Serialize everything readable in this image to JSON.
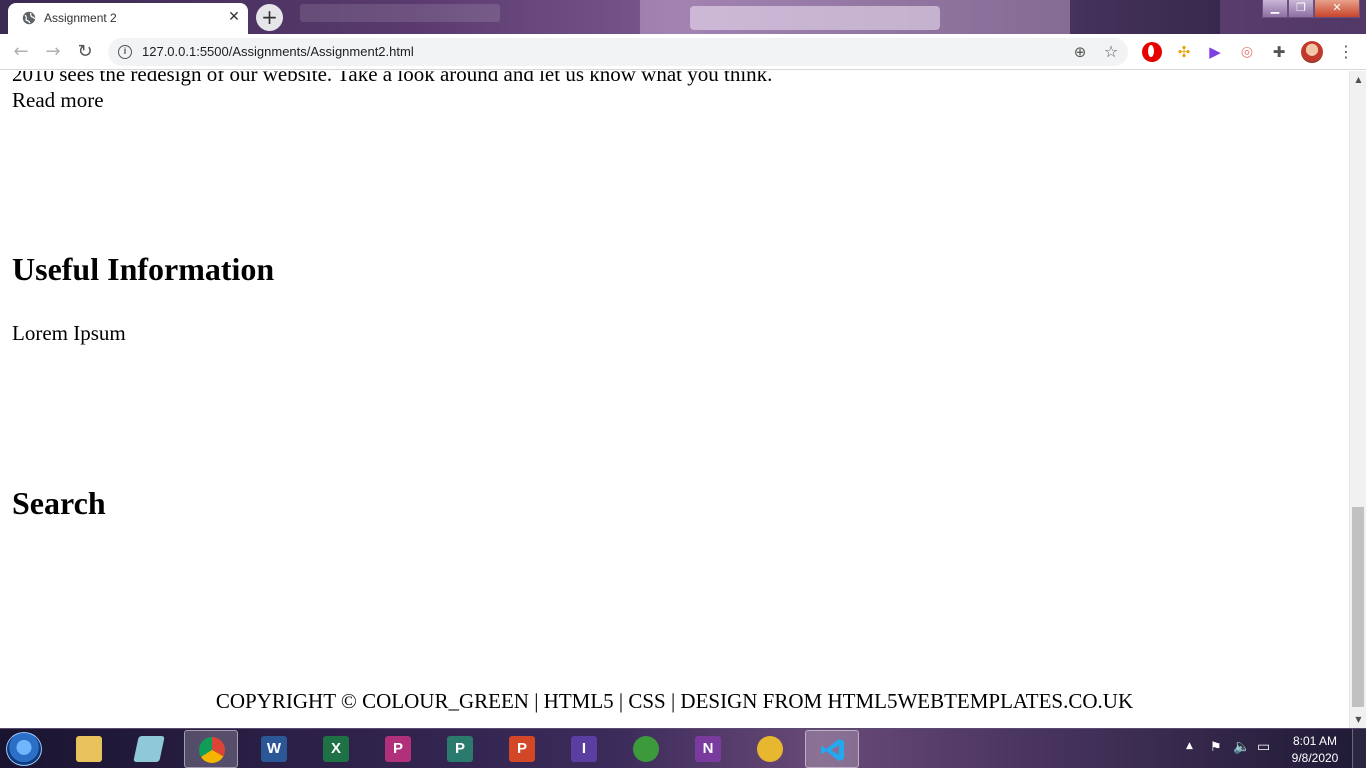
{
  "browser": {
    "tab_title": "Assignment 2",
    "close_glyph": "✕",
    "new_tab_glyph": "+",
    "url": "127.0.0.1:5500/Assignments/Assignment2.html",
    "window_controls": {
      "minimize": "▁",
      "maximize": "❐",
      "close": "✕"
    },
    "icons": {
      "back": "arrow-left-icon",
      "forward": "arrow-right-icon",
      "reload": "reload-icon",
      "site_info": "info-icon",
      "zoom": "zoom-icon",
      "bookmark": "star-icon",
      "extensions": [
        "opera-icon",
        "pinwheel-icon",
        "play-icon",
        "cast-icon",
        "puzzle-icon"
      ],
      "profile": "avatar-icon",
      "menu": "menu-dots-icon"
    }
  },
  "page": {
    "intro_text": "2010 sees the redesign of our website. Take a look around and let us know what you think.",
    "read_more": "Read more",
    "useful_heading": "Useful Information",
    "lorem": "Lorem Ipsum",
    "search_heading": "Search",
    "footer": "COPYRIGHT © COLOUR_GREEN | HTML5 | CSS | DESIGN FROM HTML5WEBTEMPLATES.CO.UK"
  },
  "taskbar": {
    "apps": [
      {
        "name": "file-explorer",
        "glyph": ""
      },
      {
        "name": "notepad-plus",
        "glyph": ""
      },
      {
        "name": "chrome",
        "glyph": "",
        "active": true
      },
      {
        "name": "word",
        "glyph": "W"
      },
      {
        "name": "excel",
        "glyph": "X"
      },
      {
        "name": "powerpoint-alt",
        "glyph": "P"
      },
      {
        "name": "publisher",
        "glyph": "P"
      },
      {
        "name": "powerpoint",
        "glyph": "P"
      },
      {
        "name": "infopath",
        "glyph": "I"
      },
      {
        "name": "sync",
        "glyph": ""
      },
      {
        "name": "onenote",
        "glyph": "N"
      },
      {
        "name": "outlook",
        "glyph": ""
      },
      {
        "name": "vscode",
        "glyph": ""
      }
    ],
    "clock_time": "8:01 AM",
    "clock_date": "9/8/2020"
  },
  "colors": {
    "page_background": "#ffffff",
    "text": "#000000",
    "omnibox": "#f1f3f4",
    "taskbar_accent": "#3b2b5a"
  }
}
